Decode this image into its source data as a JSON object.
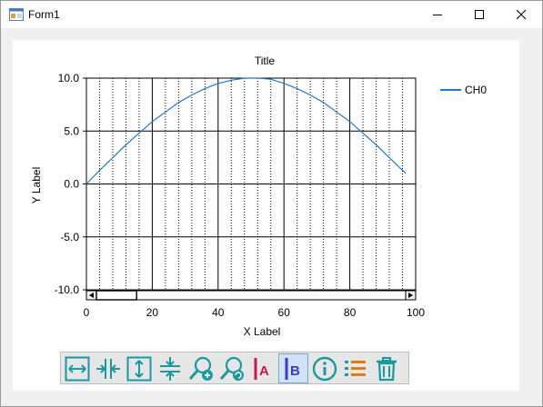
{
  "window": {
    "title": "Form1"
  },
  "chart_data": {
    "type": "line",
    "title": "Title",
    "xlabel": "X Label",
    "ylabel": "Y Label",
    "xlim": [
      0,
      100
    ],
    "ylim": [
      -10,
      10
    ],
    "x_ticks": [
      "0",
      "20",
      "40",
      "60",
      "80",
      "100"
    ],
    "y_ticks": [
      "10.0",
      "5.0",
      "0.0",
      "-5.0",
      "-10.0"
    ],
    "grid": true,
    "legend_position": "top-right",
    "series": [
      {
        "name": "CH0",
        "color": "#1f77d4",
        "x": [
          0,
          4,
          8,
          12,
          16,
          20,
          24,
          28,
          32,
          36,
          40,
          44,
          48,
          52,
          56,
          60,
          64,
          68,
          72,
          76,
          80,
          84,
          88,
          92,
          96,
          97
        ],
        "y": [
          0.0,
          1.3,
          2.5,
          3.7,
          4.8,
          5.9,
          6.8,
          7.7,
          8.4,
          9.0,
          9.5,
          9.8,
          10.0,
          10.0,
          9.9,
          9.5,
          9.0,
          8.4,
          7.7,
          6.8,
          5.9,
          4.8,
          3.7,
          2.5,
          1.3,
          1.0
        ]
      }
    ]
  },
  "scrollbar": {
    "position": 0.0,
    "visible_fraction": 0.13
  },
  "toolbar": {
    "buttons": [
      {
        "name": "fit-x-button",
        "icon": "arrows-horizontal-icon",
        "pressed": false
      },
      {
        "name": "zoom-fit-x-button",
        "icon": "arrows-inward-horizontal-icon",
        "pressed": false
      },
      {
        "name": "fit-y-button",
        "icon": "arrows-vertical-icon",
        "pressed": false
      },
      {
        "name": "zoom-fit-y-button",
        "icon": "arrows-inward-vertical-icon",
        "pressed": false
      },
      {
        "name": "zoom-in-button",
        "icon": "zoom-in-icon",
        "pressed": false
      },
      {
        "name": "zoom-reset-button",
        "icon": "zoom-refresh-icon",
        "pressed": false
      },
      {
        "name": "cursor-a-button",
        "icon": "cursor-a-icon",
        "label": "A",
        "pressed": false
      },
      {
        "name": "cursor-b-button",
        "icon": "cursor-b-icon",
        "label": "B",
        "pressed": true
      },
      {
        "name": "info-button",
        "icon": "info-icon",
        "pressed": false
      },
      {
        "name": "list-button",
        "icon": "list-icon",
        "pressed": false
      },
      {
        "name": "delete-button",
        "icon": "trash-icon",
        "pressed": false
      }
    ]
  }
}
